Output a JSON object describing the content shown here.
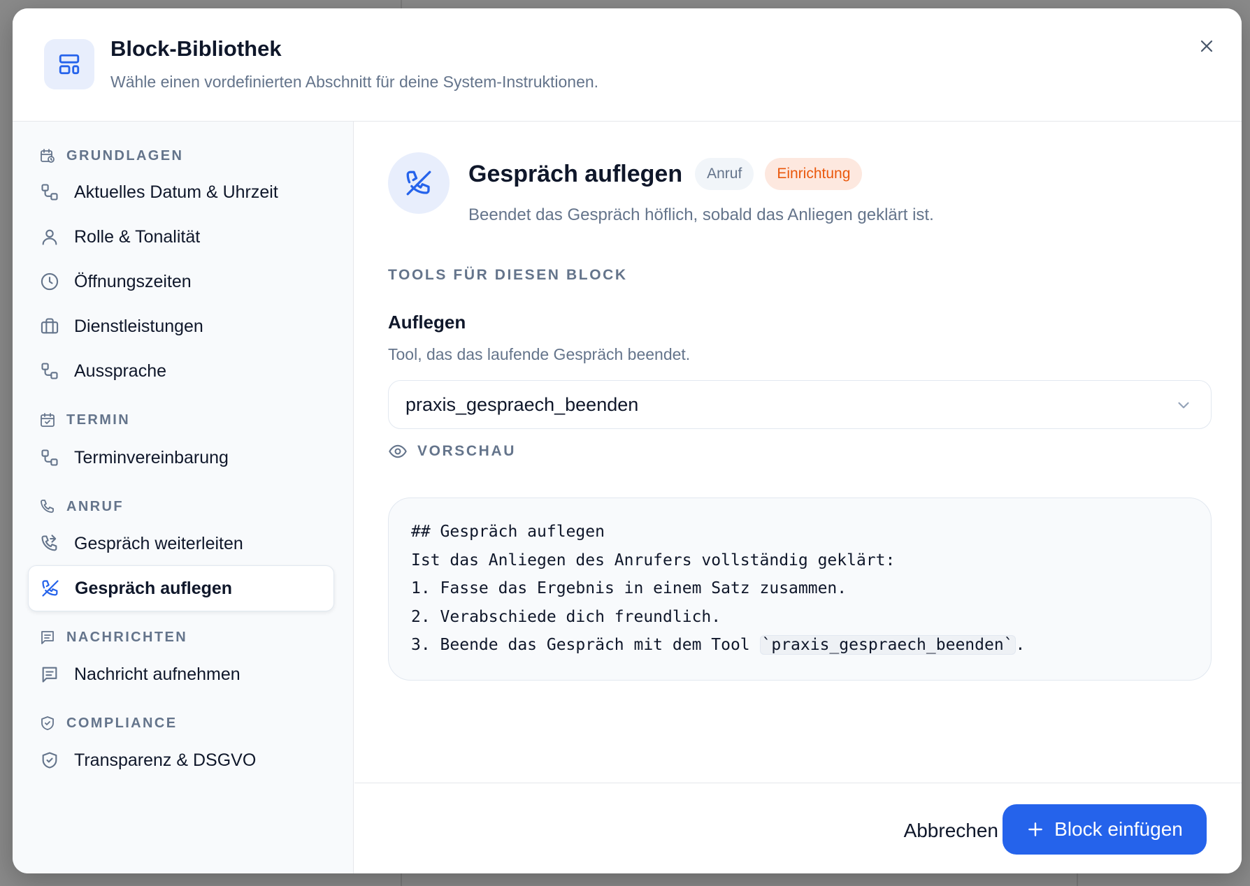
{
  "header": {
    "title": "Block-Bibliothek",
    "subtitle": "Wähle einen vordefinierten Abschnitt für deine System-Instruktionen.",
    "icon": "layout-icon",
    "close_icon": "close-icon"
  },
  "sidebar": {
    "categories": [
      {
        "label": "GRUNDLAGEN",
        "icon": "calendar-clock-icon"
      },
      {
        "label": "TERMIN",
        "icon": "calendar-check-icon"
      },
      {
        "label": "ANRUF",
        "icon": "phone-icon"
      },
      {
        "label": "NACHRICHTEN",
        "icon": "message-icon"
      },
      {
        "label": "COMPLIANCE",
        "icon": "shield-icon"
      }
    ],
    "items": [
      {
        "label": "Aktuelles Datum & Uhrzeit",
        "icon": "blocks-icon"
      },
      {
        "label": "Rolle & Tonalität",
        "icon": "user-icon"
      },
      {
        "label": "Öffnungszeiten",
        "icon": "clock-icon"
      },
      {
        "label": "Dienstleistungen",
        "icon": "briefcase-icon"
      },
      {
        "label": "Aussprache",
        "icon": "blocks-icon"
      },
      {
        "label": "Terminvereinbarung",
        "icon": "blocks-icon"
      },
      {
        "label": "Gespräch weiterleiten",
        "icon": "phone-forward-icon"
      },
      {
        "label": "Gespräch auflegen",
        "icon": "phone-off-icon",
        "active": true
      },
      {
        "label": "Nachricht aufnehmen",
        "icon": "message-icon"
      },
      {
        "label": "Transparenz & DSGVO",
        "icon": "shield-check-icon"
      }
    ]
  },
  "detail": {
    "title": "Gespräch auflegen",
    "badges": [
      "Anruf",
      "Einrichtung"
    ],
    "description": "Beendet das Gespräch höflich, sobald das Anliegen geklärt ist.",
    "tools_label": "TOOLS FÜR DIESEN BLOCK",
    "tool": {
      "name": "Auflegen",
      "description": "Tool, das das laufende Gespräch beendet.",
      "selected_value": "praxis_gespraech_beenden"
    },
    "preview_label": "VORSCHAU",
    "preview": {
      "line1": "## Gespräch auflegen",
      "line2": "Ist das Anliegen des Anrufers vollständig geklärt:",
      "line3": "1. Fasse das Ergebnis in einem Satz zusammen.",
      "line4": "2. Verabschiede dich freundlich.",
      "line5_prefix": "3. Beende das Gespräch mit dem Tool ",
      "line5_code": "`praxis_gespraech_beenden`",
      "line5_suffix": "."
    }
  },
  "footer": {
    "cancel_label": "Abbrechen",
    "insert_label": "Block einfügen"
  },
  "colors": {
    "accent": "#2563eb",
    "accent_soft": "#e8eefc",
    "badge_orange_text": "#ea580c",
    "badge_orange_bg": "#fde8df"
  }
}
